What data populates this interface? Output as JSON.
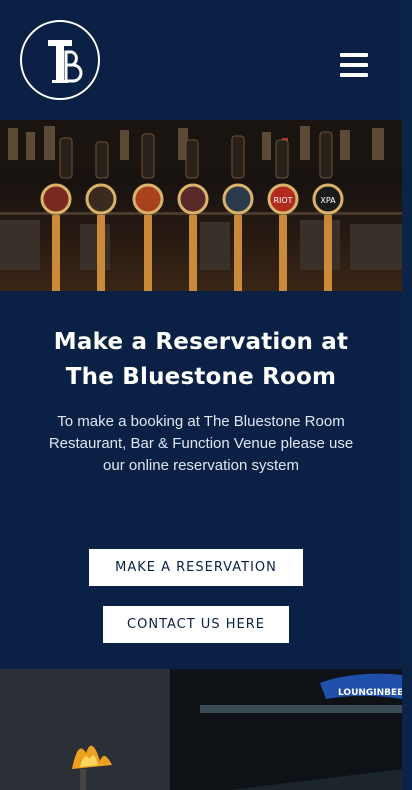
{
  "header": {
    "logo_monogram": "B",
    "logo_icon": "bluestone-monogram-logo",
    "menu_icon": "hamburger-menu-icon"
  },
  "hero": {
    "image": "bar-beer-taps-photo",
    "tap_badges": [
      "",
      "",
      "",
      "",
      "",
      "RIOT",
      "XPA"
    ]
  },
  "reservation": {
    "title": "Make a Reservation at The Bluestone Room",
    "description": "To make a booking at The Bluestone Room Restaurant, Bar & Function Venue please use our online reservation system",
    "reserve_button": "MAKE A RESERVATION",
    "contact_button": "CONTACT US HERE"
  },
  "footer_photo": {
    "image": "venue-exterior-fire-torch-photo",
    "signage_text": "LOUNGINBEER.FOOD"
  },
  "colors": {
    "navy": "#0a2145",
    "white": "#ffffff"
  }
}
